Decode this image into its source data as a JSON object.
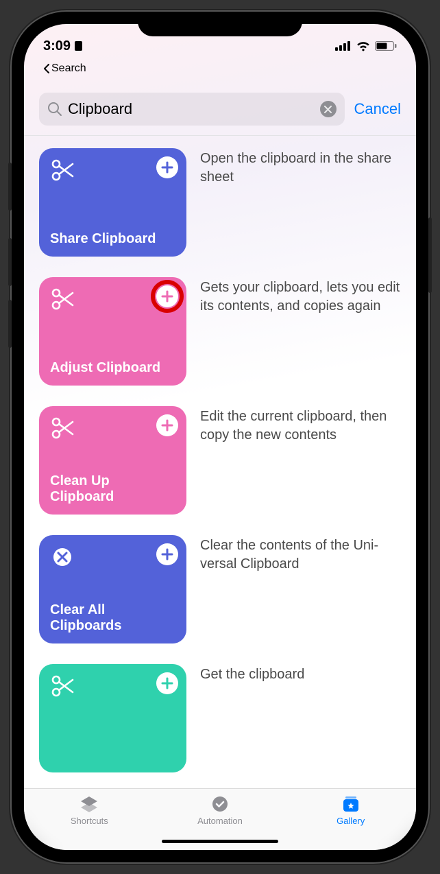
{
  "status": {
    "time": "3:09",
    "back_label": "Search"
  },
  "search": {
    "value": "Clipboard",
    "cancel_label": "Cancel"
  },
  "rows": [
    {
      "title": "Share Clipboard",
      "desc": "Open the clip­board in the share sheet",
      "color": "#5362d9",
      "icon": "scissors",
      "add_color": "#5362d9",
      "highlight": false,
      "corner_icon": null
    },
    {
      "title": "Adjust Clipboard",
      "desc": "Gets your clip­board, lets you edit its contents, and copies again",
      "color": "#ee6bb4",
      "icon": "scissors",
      "add_color": "#ee6bb4",
      "highlight": true,
      "corner_icon": null
    },
    {
      "title": "Clean Up Clipboard",
      "desc": "Edit the current clipboard, then copy the new contents",
      "color": "#ee6bb4",
      "icon": "scissors",
      "add_color": "#ee6bb4",
      "highlight": false,
      "corner_icon": null
    },
    {
      "title": "Clear All Clipboards",
      "desc": "Clear the con­tents of the Uni­versal Clipboard",
      "color": "#5362d9",
      "icon": "x-circle",
      "add_color": "#5362d9",
      "highlight": false,
      "corner_icon": null
    },
    {
      "title": "",
      "desc": "Get the clipboard",
      "color": "#2fd1ad",
      "icon": "scissors",
      "add_color": "#2fd1ad",
      "highlight": false,
      "corner_icon": null
    }
  ],
  "tabs": {
    "shortcuts": "Shortcuts",
    "automation": "Automation",
    "gallery": "Gallery"
  }
}
